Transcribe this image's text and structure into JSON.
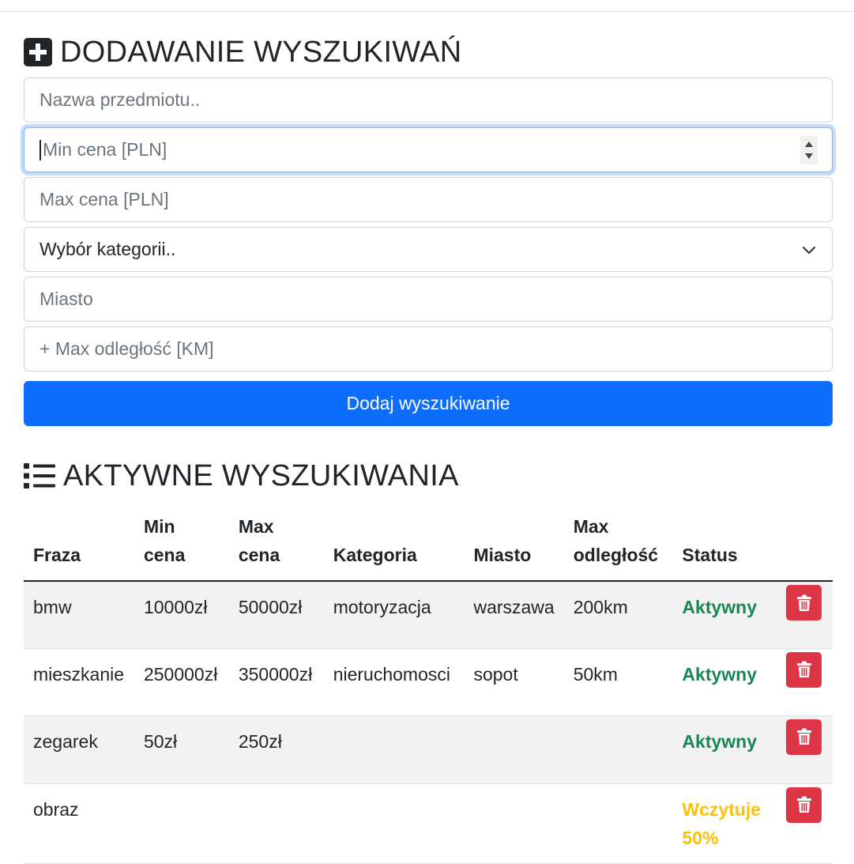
{
  "form": {
    "title": "DODAWANIE WYSZUKIWAŃ",
    "title_icon": "plus-square-icon",
    "name_placeholder": "Nazwa przedmiotu..",
    "min_price_placeholder": "Min cena [PLN]",
    "max_price_placeholder": "Max cena [PLN]",
    "category_selected": "Wybór kategorii..",
    "city_placeholder": "Miasto",
    "distance_placeholder": "+ Max odległość [KM]",
    "submit_label": "Dodaj wyszukiwanie"
  },
  "list": {
    "title": "AKTYWNE WYSZUKIWANIA",
    "title_icon": "list-icon",
    "headers": {
      "phrase": "Fraza",
      "min_1": "Min",
      "min_2": "cena",
      "max_1": "Max",
      "max_2": "cena",
      "category": "Kategoria",
      "city": "Miasto",
      "dist_1": "Max",
      "dist_2": "odległość",
      "status": "Status"
    },
    "rows": [
      {
        "phrase": "bmw",
        "min": "10000zł",
        "max": "50000zł",
        "category": "motoryzacja",
        "city": "warszawa",
        "distance": "200km",
        "status_1": "Aktywny",
        "status_2": ""
      },
      {
        "phrase": "mieszkanie",
        "min": "250000zł",
        "max": "350000zł",
        "category": "nieruchomosci",
        "city": "sopot",
        "distance": "50km",
        "status_1": "Aktywny",
        "status_2": ""
      },
      {
        "phrase": "zegarek",
        "min": "50zł",
        "max": "250zł",
        "category": "",
        "city": "",
        "distance": "",
        "status_1": "Aktywny",
        "status_2": ""
      },
      {
        "phrase": "obraz",
        "min": "",
        "max": "",
        "category": "",
        "city": "",
        "distance": "",
        "status_1": "Wczytuje",
        "status_2": "50%"
      }
    ],
    "delete_icon": "trash-icon"
  },
  "colors": {
    "primary": "#0d6efd",
    "danger": "#dc3545",
    "success": "#198754",
    "warning": "#ffc107"
  }
}
